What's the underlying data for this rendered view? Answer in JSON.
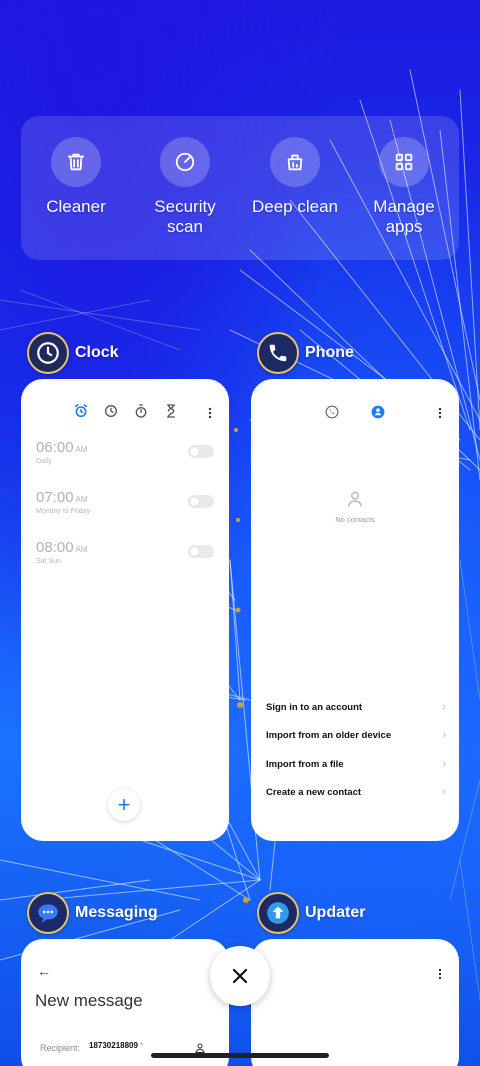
{
  "quick_actions": [
    {
      "label": "Cleaner",
      "icon": "trash-icon"
    },
    {
      "label": "Security scan",
      "icon": "gauge-icon"
    },
    {
      "label": "Deep clean",
      "icon": "bag-icon"
    },
    {
      "label": "Manage apps",
      "icon": "grid-icon"
    }
  ],
  "apps": {
    "clock": {
      "name": "Clock",
      "alarms": [
        {
          "time": "06:00",
          "ampm": "AM",
          "repeat": "Daily"
        },
        {
          "time": "07:00",
          "ampm": "AM",
          "repeat": "Monday to Friday"
        },
        {
          "time": "08:00",
          "ampm": "AM",
          "repeat": "Sat Sun"
        }
      ],
      "fab": "+"
    },
    "phone": {
      "name": "Phone",
      "empty_text": "No contacts",
      "options": [
        "Sign in to an account",
        "Import from an older device",
        "Import from a file",
        "Create a new contact"
      ]
    },
    "messaging": {
      "name": "Messaging",
      "title": "New message",
      "recipient_label": "Recipient:",
      "recipient_value": "18730218809"
    },
    "updater": {
      "name": "Updater"
    }
  },
  "colors": {
    "accent": "#1e7cf2",
    "wallpaper": "#1339ee"
  }
}
